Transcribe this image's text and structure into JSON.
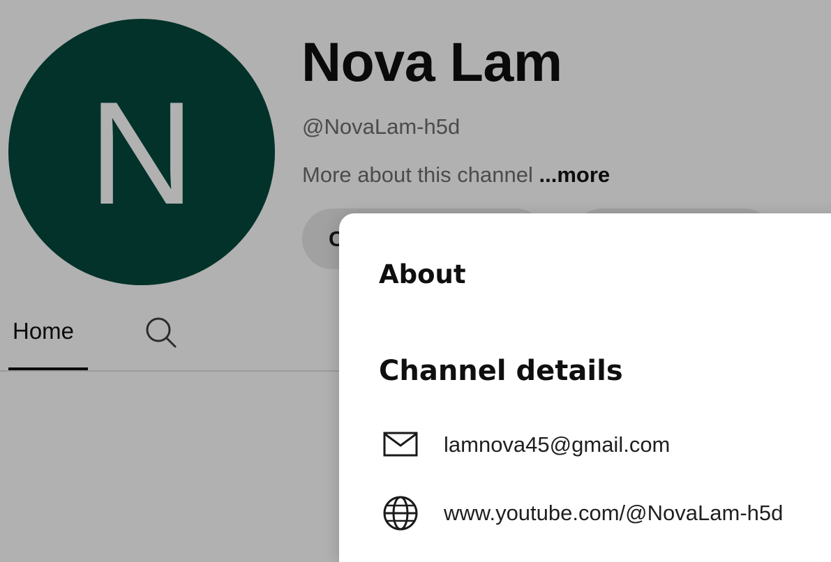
{
  "channel": {
    "avatar_letter": "N",
    "avatar_color": "#02322a",
    "name": "Nova Lam",
    "handle": "@NovaLam-h5d",
    "description": "More about this channel",
    "more_label": "...more",
    "subscribe_label_visible": "C"
  },
  "tabs": {
    "home_label": "Home",
    "search_icon": "search-icon"
  },
  "about": {
    "title": "About",
    "details_heading": "Channel details",
    "email": "lamnova45@gmail.com",
    "email_icon": "mail-icon",
    "url": "www.youtube.com/@NovaLam-h5d",
    "url_icon": "globe-icon"
  },
  "colors": {
    "page_scrim": "#b1b1b1",
    "panel_background": "#ffffff",
    "text_primary": "#0f0f0f",
    "text_secondary": "#4b4b4b"
  }
}
